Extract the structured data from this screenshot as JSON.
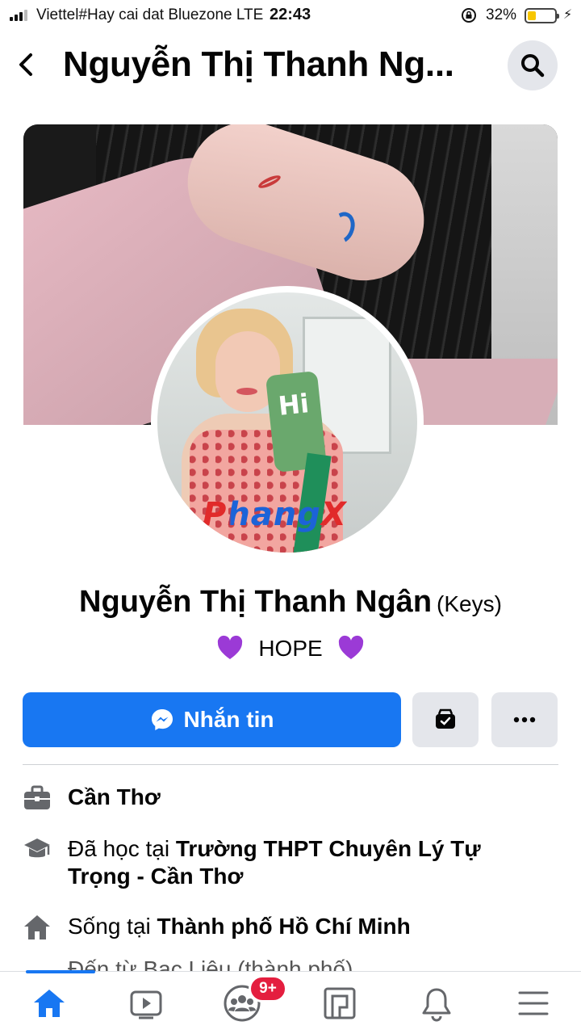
{
  "status_bar": {
    "carrier": "Viettel#Hay cai dat Bluezone  LTE",
    "time": "22:43",
    "battery_percent": "32%",
    "battery_level": 0.32
  },
  "header": {
    "title": "Nguyễn Thị Thanh Ng...",
    "back_icon": "chevron-left-icon",
    "search_icon": "search-icon"
  },
  "profile": {
    "watermark": "PhangX",
    "name": "Nguyễn Thị Thanh Ngân",
    "alt_name": "(Keys)",
    "bio": "HOPE",
    "bio_emoji": "purple-heart-icon"
  },
  "actions": {
    "message_label": "Nhắn tin",
    "message_icon": "messenger-icon",
    "second_icon": "wallet-icon",
    "more_icon": "more-dots-icon"
  },
  "details": [
    {
      "icon": "briefcase-icon",
      "prefix": "",
      "bold": "Cần Thơ"
    },
    {
      "icon": "graduation-cap-icon",
      "prefix": "Đã học tại ",
      "bold": "Trường THPT Chuyên Lý Tự Trọng - Cần Thơ"
    },
    {
      "icon": "home-icon",
      "prefix": "Sống tại ",
      "bold": "Thành phố Hồ Chí Minh"
    }
  ],
  "peek_text": "Đến từ Bạc Liêu (thành phố)",
  "tabbar": {
    "tabs": [
      "home-icon",
      "watch-icon",
      "groups-icon",
      "pages-icon",
      "notifications-icon",
      "menu-icon"
    ],
    "active": "home-icon",
    "groups_badge": "9+"
  },
  "colors": {
    "accent": "#1877f2",
    "badge": "#e41e3f",
    "button_gray": "#e4e6eb",
    "battery": "#f7c600"
  }
}
